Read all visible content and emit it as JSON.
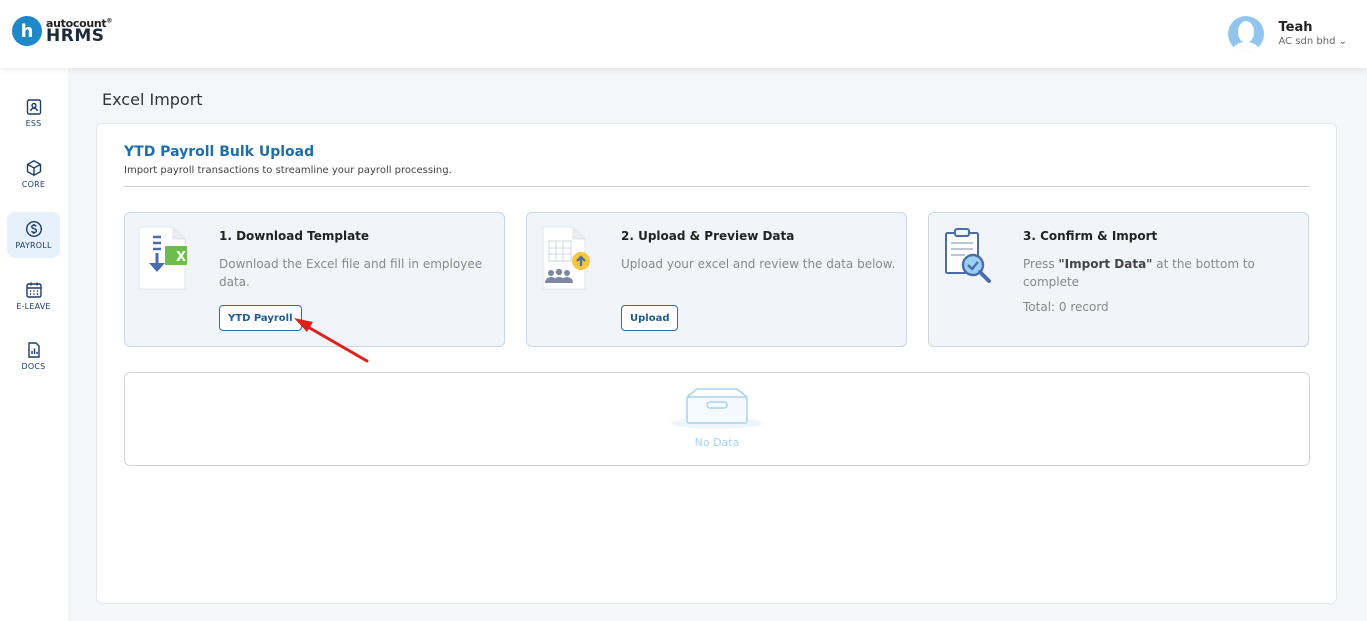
{
  "brand": {
    "logo_letter": "h",
    "name_top": "autocount",
    "name_top_mark": "®",
    "name_bottom": "HRMS"
  },
  "user": {
    "name": "Teah",
    "company": "AC sdn bhd",
    "chevron": "⌄"
  },
  "sidebar": {
    "items": [
      {
        "label": "ESS",
        "icon": "ess-icon"
      },
      {
        "label": "CORE",
        "icon": "cube-icon"
      },
      {
        "label": "PAYROLL",
        "icon": "dollar-circle-icon",
        "active": true
      },
      {
        "label": "E-LEAVE",
        "icon": "calendar-icon"
      },
      {
        "label": "DOCS",
        "icon": "document-chart-icon"
      }
    ]
  },
  "page": {
    "title": "Excel Import"
  },
  "card": {
    "title": "YTD Payroll Bulk Upload",
    "subtitle": "Import payroll transactions to streamline your payroll processing."
  },
  "steps": [
    {
      "title": "1. Download Template",
      "description": "Download the Excel file and fill in employee data.",
      "button": "YTD Payroll",
      "icon": "excel-download-icon"
    },
    {
      "title": "2. Upload & Preview Data",
      "description": "Upload your excel and review the data below.",
      "button": "Upload",
      "icon": "upload-preview-icon"
    },
    {
      "title": "3. Confirm & Import",
      "description_prefix": "Press ",
      "description_strong": "\"Import Data\"",
      "description_suffix": " at the bottom to complete",
      "total": "Total: 0 record",
      "icon": "clipboard-check-icon"
    }
  ],
  "table": {
    "empty_text": "No Data",
    "icon": "empty-box-icon"
  },
  "colors": {
    "accent": "#1e6ea8",
    "active_nav": "#e6f1fb",
    "annotation_arrow": "#e0201b"
  }
}
